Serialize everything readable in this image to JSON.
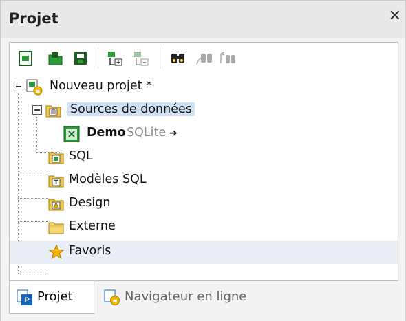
{
  "panel": {
    "title": "Projet",
    "close_glyph": "✕"
  },
  "toolbar": {
    "icons": [
      "new-project-icon",
      "open-project-icon",
      "save-project-icon",
      "add-files-icon",
      "remove-files-icon",
      "find-icon",
      "find-next-icon",
      "replace-icon"
    ]
  },
  "tree": {
    "root": {
      "label": "Nouveau projet *"
    },
    "datasources": {
      "label": "Sources de données"
    },
    "demo": {
      "name": "Demo",
      "type": "SQLite",
      "arrow": "➜"
    },
    "items": [
      {
        "label": "SQL"
      },
      {
        "label": "Modèles SQL"
      },
      {
        "label": "Design"
      },
      {
        "label": "Externe"
      },
      {
        "label": "Favoris"
      }
    ]
  },
  "tabs": [
    {
      "label": "Projet",
      "active": true
    },
    {
      "label": "Navigateur en ligne",
      "active": false
    }
  ],
  "colors": {
    "selection": "#cfe1f5",
    "folder": "#f2c94c",
    "star": "#f5b800",
    "green": "#2e9b3a"
  }
}
